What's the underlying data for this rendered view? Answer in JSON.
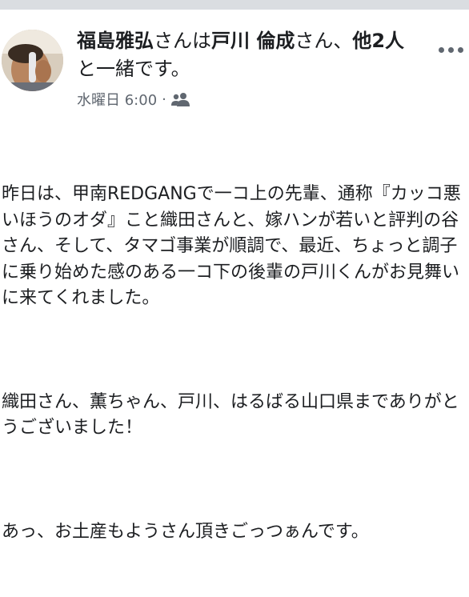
{
  "header": {
    "author": "福島雅弘",
    "connector1": "さんは",
    "tagged": "戸川 倫成",
    "connector2": "さん、",
    "others": "他2人",
    "suffix": "と一緒です。"
  },
  "meta": {
    "time": "水曜日 6:00",
    "separator": "·",
    "audience_icon": "friends-icon"
  },
  "post": {
    "paragraphs": [
      "昨日は、甲南REDGANGで一コ上の先輩、通称『カッコ悪いほうのオダ』こと織田さんと、嫁ハンが若いと評判の谷さん、そして、タマゴ事業が順調で、最近、ちょっと調子に乗り始めた感のある一コ下の後輩の戸川くんがお見舞いに来てくれました。",
      "織田さん、薫ちゃん、戸川、はるばる山口県までありがとうございました！",
      "あっ、お土産もようさん頂きごっつぁんです。"
    ]
  },
  "colors": {
    "text": "#1c1e21",
    "meta": "#606770",
    "divider": "#dadde1"
  }
}
